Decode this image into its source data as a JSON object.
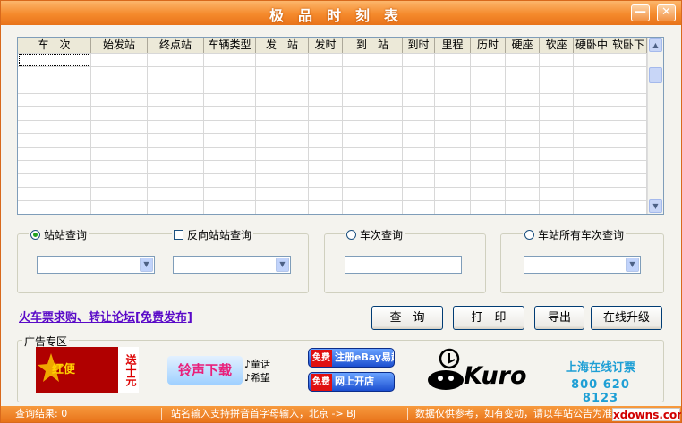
{
  "window": {
    "title": "极品时刻表",
    "min_glyph": "—",
    "close_glyph": "✕"
  },
  "table": {
    "columns": [
      "车　次",
      "始发站",
      "终点站",
      "车辆类型",
      "发　站",
      "发时",
      "到　站",
      "到时",
      "里程",
      "历时",
      "硬座",
      "软座",
      "硬卧中",
      "软卧下"
    ],
    "rows": []
  },
  "scrollbar": {
    "up_glyph": "▲",
    "down_glyph": "▼"
  },
  "query_modes": {
    "station_to_station": {
      "label": "站站查询",
      "selected": true,
      "from_value": "",
      "to_value": ""
    },
    "reverse_station": {
      "label": "反向站站查询",
      "checked": false,
      "value": ""
    },
    "train_number": {
      "label": "车次查询",
      "selected": false,
      "value": ""
    },
    "station_all_trains": {
      "label": "车站所有车次查询",
      "selected": false,
      "value": ""
    }
  },
  "dropdown_glyph": "▼",
  "forum_link": "火车票求购、转让论坛[免费发布]",
  "buttons": {
    "query": "查　询",
    "print": "打　印",
    "export": "导出",
    "upgrade": "在线升级"
  },
  "ads": {
    "section_label": "广告专区",
    "hongbian": {
      "logo": "红便",
      "gift": "送十元"
    },
    "ringtone": {
      "main": "铃声下载",
      "sub1": "♪童话",
      "sub2": "♪希望"
    },
    "ebay": {
      "tag1": "免费",
      "text1": "注册eBay易趣",
      "tag2": "免费",
      "text2": "网上开店"
    },
    "kuro": {
      "brand": "Kuro"
    },
    "shanghai": {
      "line1": "上海在线订票",
      "line2": "800 620 8123"
    }
  },
  "status": {
    "result": "查询结果: 0",
    "hint": "站名输入支持拼音首字母输入，北京 -> BJ",
    "notice": "数据仅供参考，如有变动，请以车站公告为准"
  },
  "watermark": "xdowns.com",
  "colors": {
    "accent": "#f58a2c",
    "link": "#5a0ac8",
    "radio_on": "#21a121"
  }
}
